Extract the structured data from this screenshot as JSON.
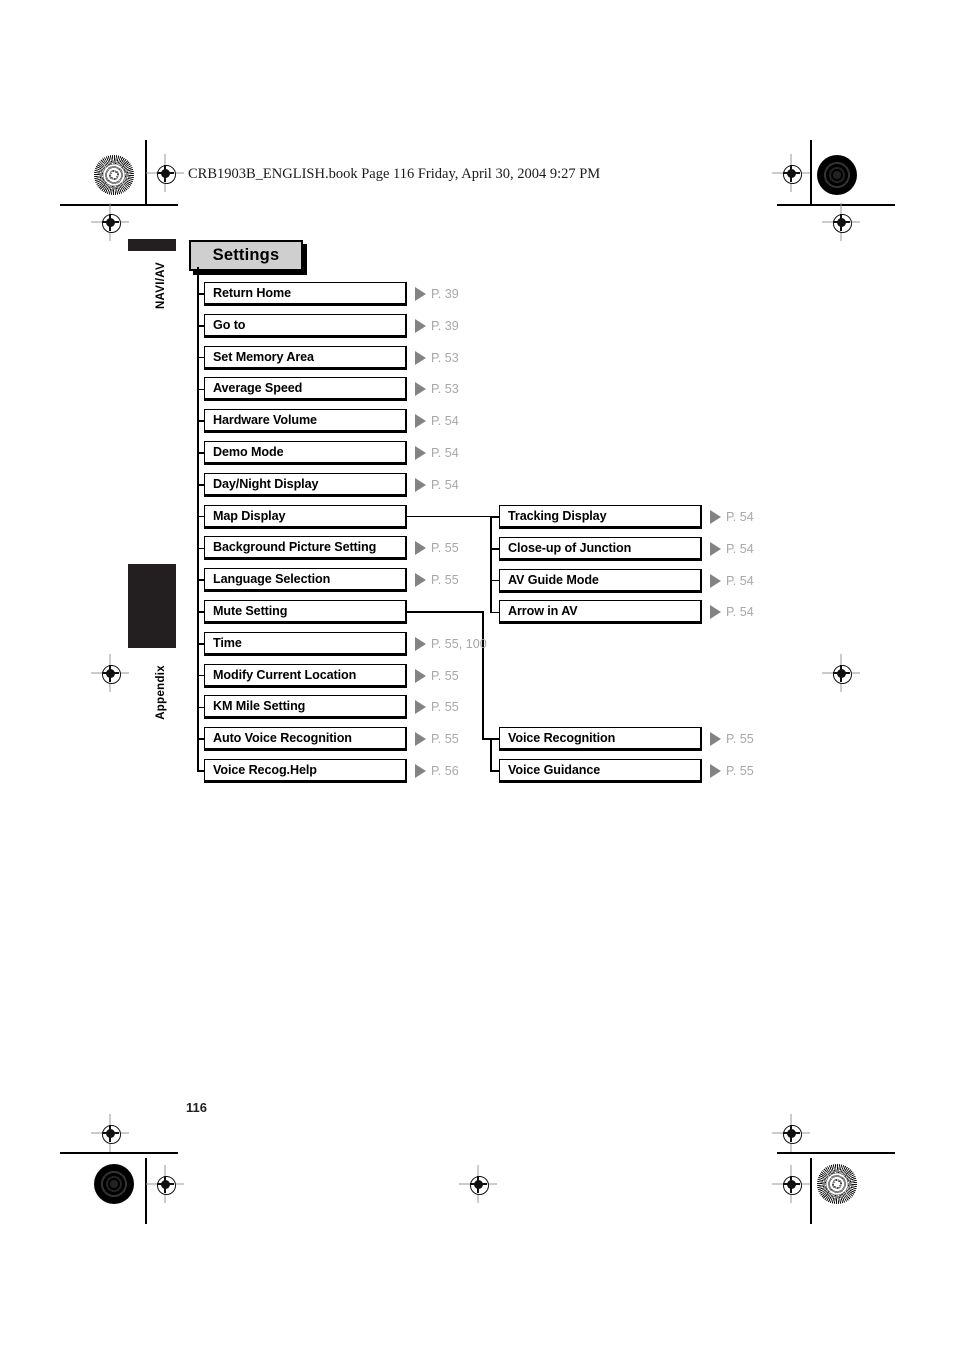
{
  "header": {
    "book_line": "CRB1903B_ENGLISH.book  Page 116  Friday, April 30, 2004  9:27 PM"
  },
  "side_tabs": [
    {
      "label": "NAVI/AV"
    },
    {
      "label": "Appendix"
    }
  ],
  "title": {
    "label": "Settings"
  },
  "colors": {
    "title_fill": "#cfcfcf",
    "tab_black": "#231f20",
    "triangle_gray": "#838383",
    "page_ref_gray": "#a8a8a8",
    "line_black": "#000000"
  },
  "main_menu": [
    {
      "label": "Return Home",
      "page_ref": "P. 39"
    },
    {
      "label": "Go to",
      "page_ref": "P. 39"
    },
    {
      "label": "Set Memory Area",
      "page_ref": "P. 53"
    },
    {
      "label": "Average Speed",
      "page_ref": "P. 53"
    },
    {
      "label": "Hardware Volume",
      "page_ref": "P. 54"
    },
    {
      "label": "Demo Mode",
      "page_ref": "P. 54"
    },
    {
      "label": "Day/Night Display",
      "page_ref": "P. 54"
    },
    {
      "label": "Map Display",
      "page_ref": ""
    },
    {
      "label": "Background Picture Setting",
      "page_ref": "P. 55"
    },
    {
      "label": "Language Selection",
      "page_ref": "P. 55"
    },
    {
      "label": "Mute Setting",
      "page_ref": ""
    },
    {
      "label": "Time",
      "page_ref": "P. 55, 100"
    },
    {
      "label": "Modify Current Location",
      "page_ref": "P. 55"
    },
    {
      "label": "KM Mile Setting",
      "page_ref": "P. 55"
    },
    {
      "label": "Auto Voice Recognition",
      "page_ref": "P. 55"
    },
    {
      "label": "Voice Recog.Help",
      "page_ref": "P. 56"
    }
  ],
  "map_display_submenu": [
    {
      "label": "Tracking Display",
      "page_ref": "P. 54"
    },
    {
      "label": "Close-up of Junction",
      "page_ref": "P. 54"
    },
    {
      "label": "AV Guide Mode",
      "page_ref": "P. 54"
    },
    {
      "label": "Arrow in AV",
      "page_ref": "P. 54"
    }
  ],
  "mute_setting_submenu": [
    {
      "label": "Voice Recognition",
      "page_ref": "P. 55"
    },
    {
      "label": "Voice Guidance",
      "page_ref": "P. 55"
    }
  ],
  "footer": {
    "page_number": "116"
  }
}
